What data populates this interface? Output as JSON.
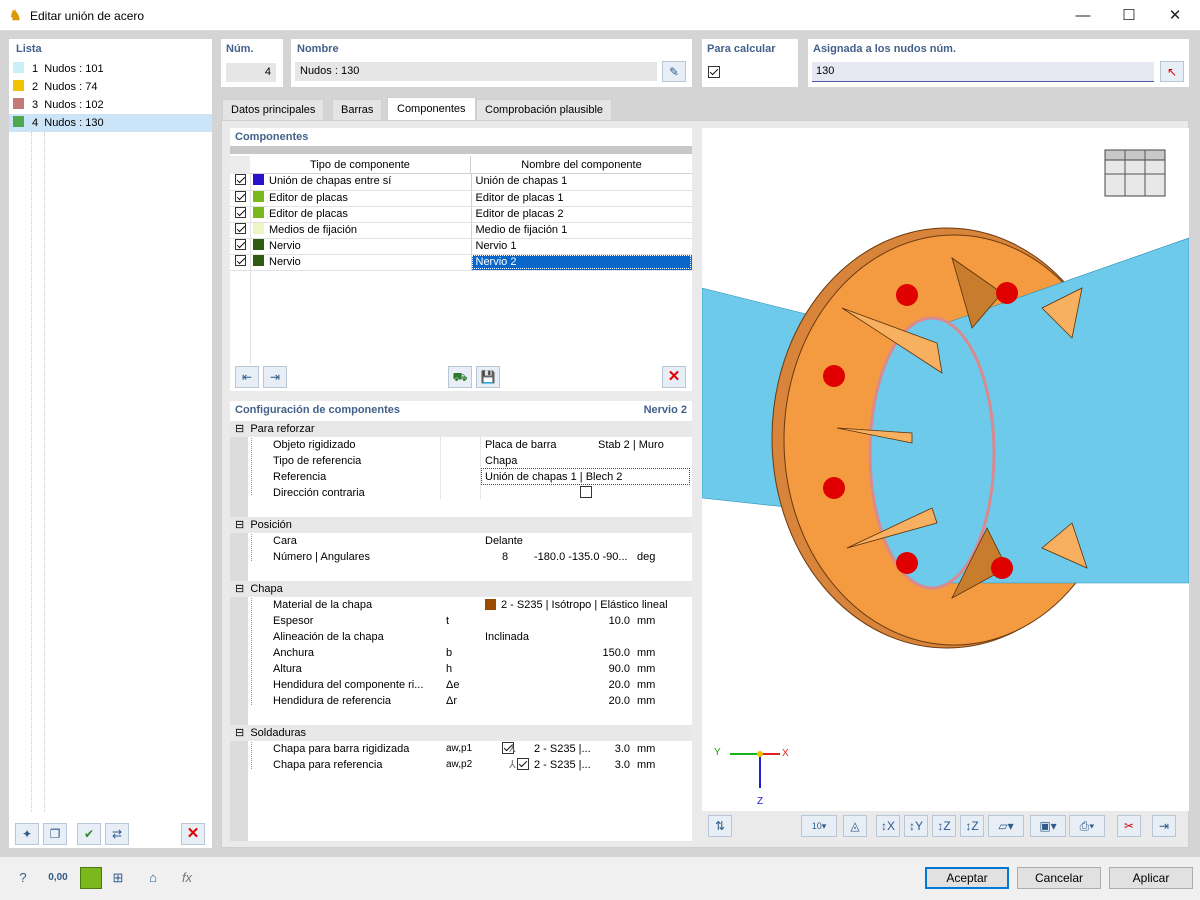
{
  "window": {
    "title": "Editar unión de acero",
    "minimize": "—",
    "maximize": "☐",
    "close": "✕"
  },
  "list": {
    "header": "Lista",
    "items": [
      {
        "num": "1",
        "label": "Nudos : 101",
        "color": "#c9f0f8"
      },
      {
        "num": "2",
        "label": "Nudos : 74",
        "color": "#f2c200"
      },
      {
        "num": "3",
        "label": "Nudos : 102",
        "color": "#c47a78"
      },
      {
        "num": "4",
        "label": "Nudos : 130",
        "color": "#4ea94e"
      }
    ]
  },
  "header": {
    "num_label": "Núm.",
    "num_value": "4",
    "name_label": "Nombre",
    "name_value": "Nudos : 130",
    "calc_label": "Para calcular",
    "assigned_label": "Asignada a los nudos núm.",
    "assigned_value": "130"
  },
  "tabs": [
    "Datos principales",
    "Barras",
    "Componentes",
    "Comprobación plausible"
  ],
  "components": {
    "title": "Componentes",
    "col1": "Tipo de componente",
    "col2": "Nombre del componente",
    "rows": [
      {
        "type": "Unión de chapas entre sí",
        "name": "Unión de chapas 1",
        "color": "#2a12c8"
      },
      {
        "type": "Editor de placas",
        "name": "Editor de placas 1",
        "color": "#7ab81e"
      },
      {
        "type": "Editor de placas",
        "name": "Editor de placas 2",
        "color": "#7ab81e"
      },
      {
        "type": "Medios de fijación",
        "name": "Medio de fijación 1",
        "color": "#eef5c2"
      },
      {
        "type": "Nervio",
        "name": "Nervio 1",
        "color": "#2e5a12"
      },
      {
        "type": "Nervio",
        "name": "Nervio 2",
        "color": "#2e5a12"
      }
    ]
  },
  "config": {
    "title": "Configuración de componentes",
    "selected": "Nervio 2",
    "g1": "Para reforzar",
    "obj_label": "Objeto rigidizado",
    "obj_v1": "Placa de barra",
    "obj_v2": "Stab 2 | Muro",
    "reftype_label": "Tipo de referencia",
    "reftype_v": "Chapa",
    "ref_label": "Referencia",
    "ref_v": "Unión de chapas 1 | Blech 2",
    "dir_label": "Dirección contraria",
    "g2": "Posición",
    "cara_label": "Cara",
    "cara_v": "Delante",
    "num_label": "Número | Angulares",
    "num_v": "8",
    "ang_v": "-180.0 -135.0 -90...",
    "deg": "deg",
    "g3": "Chapa",
    "mat_label": "Material de la chapa",
    "mat_v": "2 - S235 | Isótropo | Elástico lineal",
    "mat_color": "#9c4a00",
    "esp_label": "Espesor",
    "esp_sym": "t",
    "esp_v": "10.0",
    "alin_label": "Alineación de la chapa",
    "alin_v": "Inclinada",
    "anch_label": "Anchura",
    "anch_sym": "b",
    "anch_v": "150.0",
    "alt_label": "Altura",
    "alt_sym": "h",
    "alt_v": "90.0",
    "hend1_label": "Hendidura del componente ri...",
    "hend1_sym": "Δe",
    "hend1_v": "20.0",
    "hend2_label": "Hendidura de referencia",
    "hend2_sym": "Δr",
    "hend2_v": "20.0",
    "mm": "mm",
    "g4": "Soldaduras",
    "w1_label": "Chapa para barra rigidizada",
    "w1_sym": "aw,p1",
    "w1_mat": "2 - S235 |...",
    "w1_v": "3.0",
    "w2_label": "Chapa para referencia",
    "w2_sym": "aw,p2",
    "w2_mat": "2 - S235 |...",
    "w2_v": "3.0"
  },
  "view": {
    "axis_y": "Y",
    "axis_x": "X",
    "axis_z": "Z"
  },
  "buttons": {
    "ok": "Aceptar",
    "cancel": "Cancelar",
    "apply": "Aplicar"
  },
  "bottom_icons": {
    "units": "0,00"
  }
}
